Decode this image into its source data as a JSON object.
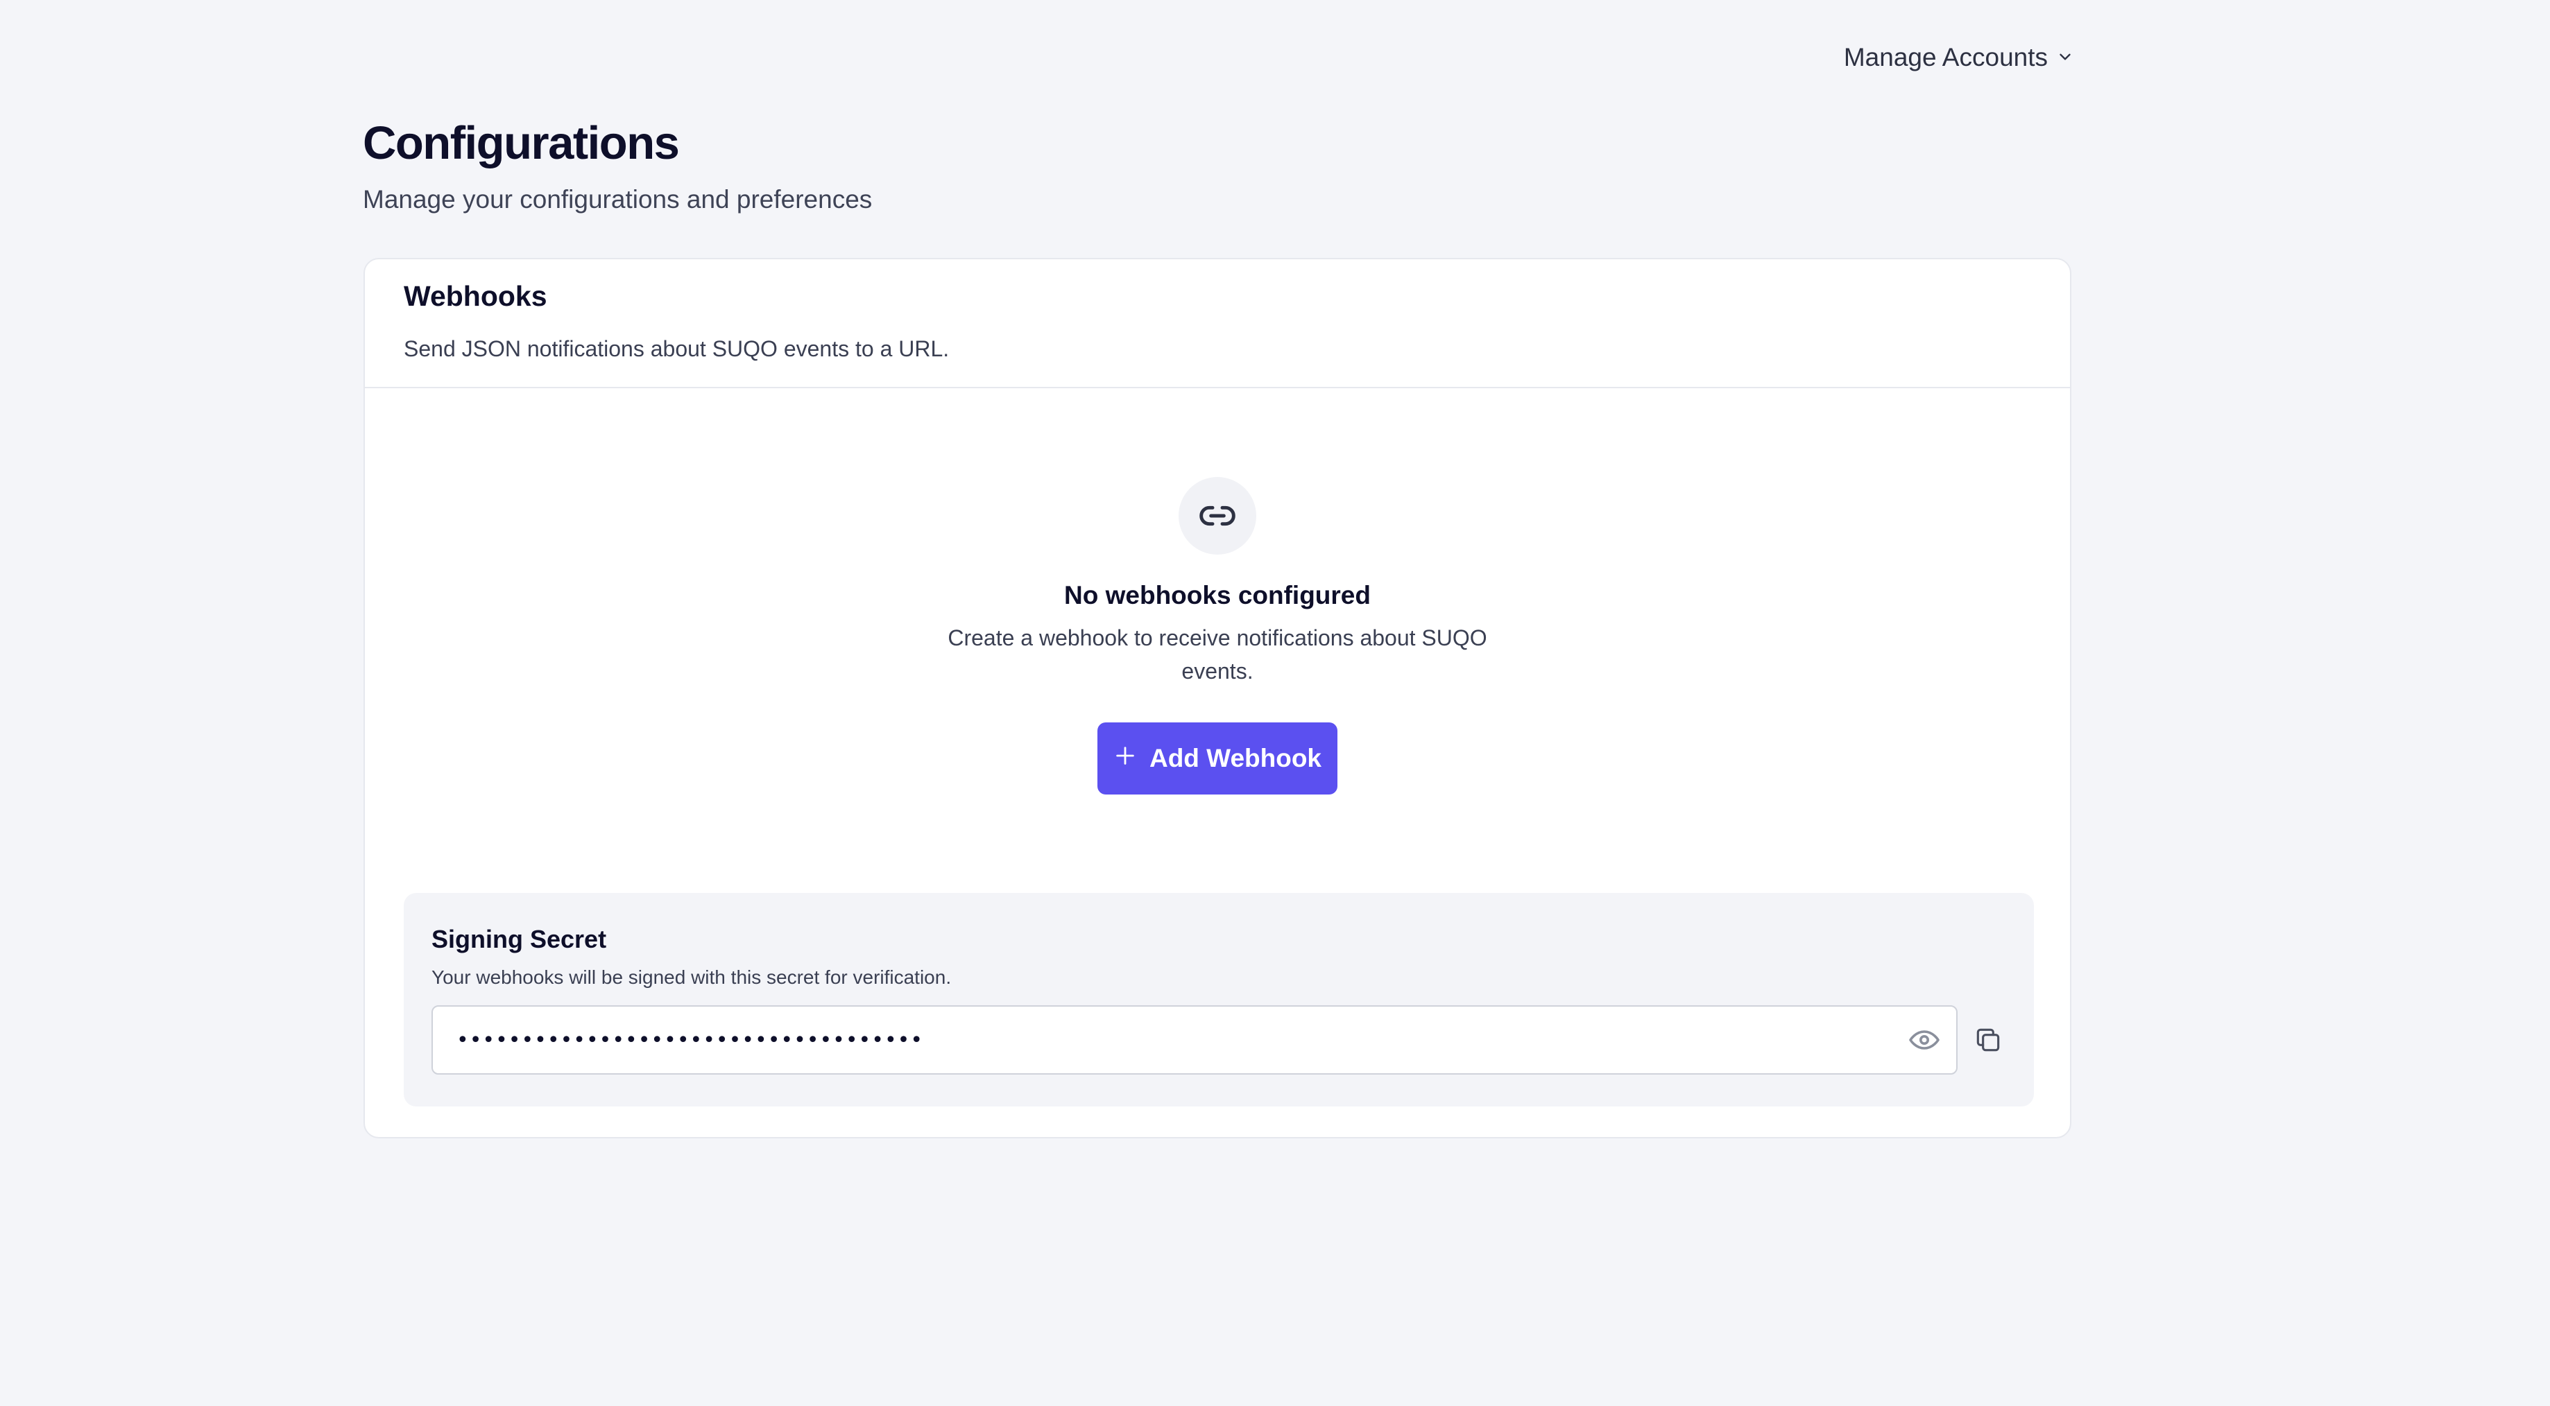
{
  "top_nav": {
    "manage_accounts_label": "Manage Accounts"
  },
  "header": {
    "title": "Configurations",
    "subtitle": "Manage your configurations and preferences"
  },
  "webhooks_card": {
    "title": "Webhooks",
    "description": "Send JSON notifications about SUQO events to a URL.",
    "empty_state": {
      "icon": "link-icon",
      "title": "No webhooks configured",
      "description": "Create a webhook to receive notifications about SUQO events.",
      "add_button_label": "Add Webhook"
    },
    "signing_secret": {
      "title": "Signing Secret",
      "description": "Your webhooks will be signed with this secret for verification.",
      "masked_value": "••••••••••••••••••••••••••••••••••••",
      "reveal_icon": "eye-icon",
      "copy_icon": "copy-icon"
    }
  },
  "colors": {
    "background": "#f4f5f9",
    "accent": "#5b50f0",
    "card": "#ffffff",
    "panel": "#f3f4f8"
  }
}
